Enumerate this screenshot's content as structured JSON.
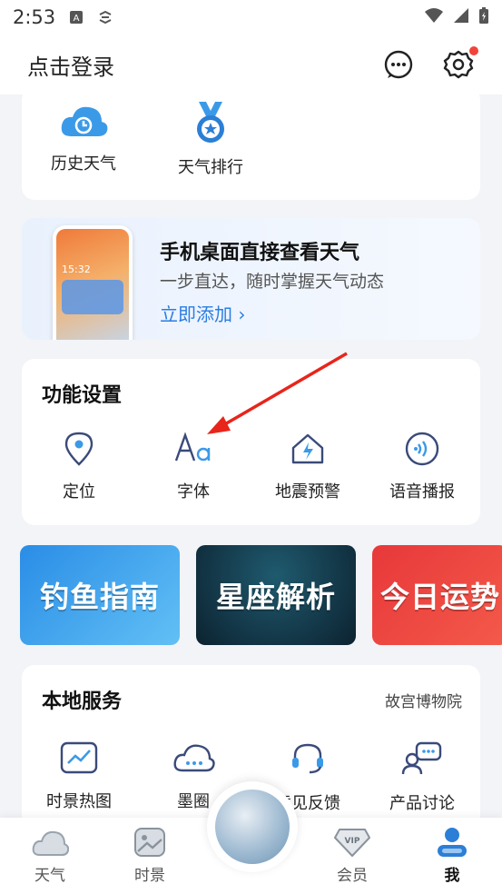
{
  "status_bar": {
    "time": "2:53"
  },
  "header": {
    "login_text": "点击登录"
  },
  "top_card": {
    "items": [
      {
        "label": "历史天气",
        "icon": "history-weather-icon"
      },
      {
        "label": "天气排行",
        "icon": "weather-ranking-medal-icon"
      }
    ]
  },
  "promo": {
    "title": "手机桌面直接查看天气",
    "subtitle": "一步直达，随时掌握天气动态",
    "link": "立即添加 ›",
    "phone_time": "15:32"
  },
  "function_settings": {
    "title": "功能设置",
    "items": [
      {
        "label": "定位",
        "icon": "location-pin-icon"
      },
      {
        "label": "字体",
        "icon": "font-aa-icon"
      },
      {
        "label": "地震预警",
        "icon": "earthquake-warning-icon"
      },
      {
        "label": "语音播报",
        "icon": "voice-broadcast-icon"
      }
    ]
  },
  "banners": [
    {
      "text": "钓鱼指南"
    },
    {
      "text": "星座解析"
    },
    {
      "text": "今日运势"
    }
  ],
  "local_services": {
    "title": "本地服务",
    "more": "故宫博物院",
    "items": [
      {
        "label": "时景热图",
        "icon": "heatmap-image-icon"
      },
      {
        "label": "墨圈",
        "icon": "cloud-chat-icon"
      },
      {
        "label": "意见反馈",
        "icon": "headset-feedback-icon"
      },
      {
        "label": "产品讨论",
        "icon": "discussion-icon"
      }
    ]
  },
  "tabbar": {
    "tabs": [
      {
        "label": "天气"
      },
      {
        "label": "时景"
      },
      {
        "label": "会员"
      },
      {
        "label": "我"
      }
    ]
  },
  "colors": {
    "accent": "#2a7de1",
    "badge": "#f0443a",
    "arrow": "#e8251b"
  }
}
